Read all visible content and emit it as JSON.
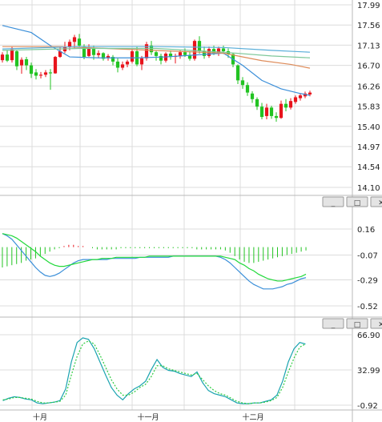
{
  "panels": [
    {
      "name": "price",
      "yticks": [
        "17.99",
        "17.56",
        "17.13",
        "16.70",
        "16.26",
        "15.83",
        "15.40",
        "14.97",
        "14.54",
        "14.10"
      ]
    },
    {
      "name": "macd",
      "yticks": [
        "0.16",
        "-0.07",
        "-0.29",
        "-0.52"
      ]
    },
    {
      "name": "kd",
      "yticks": [
        "66.90",
        "32.99",
        "-0.92"
      ]
    }
  ],
  "x_labels": [
    "十月",
    "十一月",
    "十二月"
  ],
  "colors": {
    "up": "#e8141c",
    "down": "#22c322",
    "ma5": "#3b8fd9",
    "ma10": "#de8c5a",
    "ma20": "#5aaed9",
    "ma30": "#7ec89a",
    "macd_dif": "#3b8fd9",
    "macd_dea": "#22d93b",
    "kd_k": "#1aa3b0",
    "kd_d": "#2ecc40",
    "grid": "#dcdcdc",
    "divider": "#b8b8b8"
  },
  "window_buttons": [
    "minimize",
    "maximize",
    "close"
  ],
  "chart_data": [
    {
      "type": "candlestick",
      "panel": "price",
      "ylim": [
        14.1,
        17.99
      ],
      "ohlc": [
        [
          16.81,
          16.98,
          16.76,
          16.93
        ],
        [
          16.93,
          17.02,
          16.77,
          16.8
        ],
        [
          16.81,
          17.1,
          16.76,
          17.04
        ],
        [
          17.0,
          17.02,
          16.6,
          16.68
        ],
        [
          16.7,
          16.87,
          16.52,
          16.82
        ],
        [
          16.83,
          16.88,
          16.6,
          16.7
        ],
        [
          16.7,
          16.76,
          16.43,
          16.52
        ],
        [
          16.55,
          16.62,
          16.4,
          16.48
        ],
        [
          16.48,
          16.56,
          16.42,
          16.5
        ],
        [
          16.5,
          16.6,
          16.45,
          16.55
        ],
        [
          16.55,
          16.62,
          16.18,
          16.53
        ],
        [
          16.53,
          16.9,
          16.52,
          16.88
        ],
        [
          16.88,
          17.1,
          16.86,
          17.0
        ],
        [
          17.0,
          17.2,
          16.96,
          17.1
        ],
        [
          17.1,
          17.25,
          17.02,
          17.2
        ],
        [
          17.2,
          17.35,
          17.05,
          17.3
        ],
        [
          17.27,
          17.37,
          17.08,
          17.12
        ],
        [
          17.1,
          17.15,
          16.83,
          16.88
        ],
        [
          16.9,
          17.15,
          16.88,
          17.08
        ],
        [
          17.05,
          17.12,
          16.82,
          16.92
        ],
        [
          16.92,
          17.02,
          16.86,
          16.96
        ],
        [
          16.96,
          16.98,
          16.8,
          16.84
        ],
        [
          16.86,
          16.94,
          16.8,
          16.9
        ],
        [
          16.88,
          16.92,
          16.7,
          16.78
        ],
        [
          16.78,
          16.85,
          16.55,
          16.65
        ],
        [
          16.65,
          16.78,
          16.6,
          16.72
        ],
        [
          16.72,
          16.82,
          16.66,
          16.78
        ],
        [
          16.78,
          17.05,
          16.74,
          17.0
        ],
        [
          17.0,
          17.1,
          16.68,
          16.72
        ],
        [
          16.72,
          16.9,
          16.6,
          16.85
        ],
        [
          16.85,
          17.2,
          16.8,
          17.15
        ],
        [
          17.12,
          17.22,
          16.92,
          16.98
        ],
        [
          16.98,
          17.02,
          16.8,
          16.9
        ],
        [
          16.9,
          16.95,
          16.72,
          16.8
        ],
        [
          16.8,
          16.98,
          16.76,
          16.95
        ],
        [
          16.95,
          17.02,
          16.82,
          16.88
        ],
        [
          16.88,
          16.95,
          16.74,
          16.9
        ],
        [
          16.9,
          17.02,
          16.84,
          16.98
        ],
        [
          16.98,
          17.06,
          16.88,
          16.92
        ],
        [
          16.92,
          17.0,
          16.8,
          16.84
        ],
        [
          16.84,
          17.25,
          16.8,
          17.22
        ],
        [
          17.22,
          17.32,
          16.95,
          17.0
        ],
        [
          17.0,
          17.1,
          16.84,
          16.9
        ],
        [
          16.9,
          17.1,
          16.86,
          17.05
        ],
        [
          17.05,
          17.12,
          16.92,
          16.96
        ],
        [
          16.96,
          17.1,
          16.9,
          17.06
        ],
        [
          17.06,
          17.12,
          16.94,
          17.0
        ],
        [
          17.0,
          17.06,
          16.86,
          16.94
        ],
        [
          16.94,
          16.96,
          16.66,
          16.72
        ],
        [
          16.7,
          16.72,
          16.3,
          16.38
        ],
        [
          16.38,
          16.45,
          16.2,
          16.28
        ],
        [
          16.28,
          16.34,
          16.05,
          16.12
        ],
        [
          16.1,
          16.15,
          15.9,
          15.98
        ],
        [
          15.98,
          16.02,
          15.75,
          15.82
        ],
        [
          15.82,
          15.9,
          15.55,
          15.6
        ],
        [
          15.62,
          15.88,
          15.55,
          15.8
        ],
        [
          15.8,
          15.84,
          15.56,
          15.62
        ],
        [
          15.62,
          15.7,
          15.5,
          15.58
        ],
        [
          15.58,
          15.95,
          15.56,
          15.88
        ],
        [
          15.88,
          15.98,
          15.72,
          15.8
        ],
        [
          15.8,
          16.0,
          15.76,
          15.94
        ],
        [
          15.92,
          16.06,
          15.88,
          16.02
        ],
        [
          16.0,
          16.1,
          15.95,
          16.06
        ],
        [
          16.04,
          16.14,
          16.0,
          16.1
        ],
        [
          16.08,
          16.16,
          16.04,
          16.12
        ]
      ],
      "ma_series": [
        {
          "name": "MA5",
          "points": [
            [
              0,
              17.55
            ],
            [
              6,
              17.4
            ],
            [
              10,
              17.12
            ],
            [
              14,
              16.88
            ],
            [
              20,
              16.86
            ],
            [
              28,
              16.86
            ],
            [
              34,
              16.88
            ],
            [
              40,
              16.92
            ],
            [
              46,
              16.96
            ],
            [
              50,
              16.7
            ],
            [
              54,
              16.38
            ],
            [
              58,
              16.2
            ],
            [
              62,
              16.1
            ],
            [
              64,
              16.06
            ]
          ]
        },
        {
          "name": "MA10",
          "points": [
            [
              0,
              17.1
            ],
            [
              12,
              17.1
            ],
            [
              24,
              17.05
            ],
            [
              36,
              17.0
            ],
            [
              46,
              16.96
            ],
            [
              54,
              16.8
            ],
            [
              60,
              16.72
            ],
            [
              64,
              16.64
            ]
          ]
        },
        {
          "name": "MA20",
          "points": [
            [
              0,
              17.05
            ],
            [
              16,
              17.1
            ],
            [
              32,
              17.1
            ],
            [
              46,
              17.08
            ],
            [
              56,
              17.02
            ],
            [
              64,
              16.98
            ]
          ]
        },
        {
          "name": "MA30",
          "points": [
            [
              0,
              17.02
            ],
            [
              16,
              17.06
            ],
            [
              32,
              17.06
            ],
            [
              46,
              16.98
            ],
            [
              56,
              16.9
            ],
            [
              64,
              16.86
            ]
          ]
        }
      ]
    },
    {
      "type": "macd",
      "panel": "macd",
      "ylim": [
        -0.52,
        0.16
      ],
      "histogram": [
        -0.18,
        -0.17,
        -0.16,
        -0.15,
        -0.14,
        -0.12,
        -0.11,
        -0.1,
        -0.08,
        -0.06,
        -0.04,
        -0.02,
        -0.01,
        0.01,
        0.02,
        0.02,
        0.01,
        0.01,
        0.0,
        -0.01,
        -0.02,
        -0.02,
        -0.02,
        -0.02,
        -0.02,
        -0.01,
        -0.01,
        -0.01,
        -0.01,
        -0.01,
        -0.01,
        -0.01,
        -0.01,
        -0.01,
        -0.01,
        -0.01,
        -0.01,
        -0.01,
        -0.01,
        -0.01,
        -0.01,
        -0.02,
        -0.02,
        -0.02,
        -0.02,
        -0.02,
        -0.02,
        -0.03,
        -0.05,
        -0.08,
        -0.11,
        -0.13,
        -0.14,
        -0.14,
        -0.13,
        -0.12,
        -0.11,
        -0.1,
        -0.09,
        -0.08,
        -0.07,
        -0.06,
        -0.05,
        -0.04,
        -0.03
      ],
      "dif": [
        0.12,
        0.1,
        0.07,
        0.02,
        -0.03,
        -0.08,
        -0.13,
        -0.18,
        -0.22,
        -0.25,
        -0.26,
        -0.25,
        -0.23,
        -0.2,
        -0.17,
        -0.14,
        -0.12,
        -0.11,
        -0.11,
        -0.11,
        -0.11,
        -0.11,
        -0.11,
        -0.1,
        -0.1,
        -0.1,
        -0.1,
        -0.1,
        -0.1,
        -0.09,
        -0.09,
        -0.09,
        -0.09,
        -0.09,
        -0.09,
        -0.09,
        -0.08,
        -0.08,
        -0.08,
        -0.08,
        -0.08,
        -0.08,
        -0.08,
        -0.08,
        -0.08,
        -0.08,
        -0.09,
        -0.11,
        -0.14,
        -0.18,
        -0.22,
        -0.26,
        -0.3,
        -0.33,
        -0.35,
        -0.37,
        -0.37,
        -0.37,
        -0.36,
        -0.35,
        -0.33,
        -0.32,
        -0.3,
        -0.28,
        -0.27
      ],
      "dea": [
        0.12,
        0.11,
        0.1,
        0.08,
        0.05,
        0.02,
        -0.01,
        -0.04,
        -0.08,
        -0.11,
        -0.14,
        -0.16,
        -0.17,
        -0.17,
        -0.16,
        -0.15,
        -0.14,
        -0.13,
        -0.12,
        -0.11,
        -0.11,
        -0.1,
        -0.1,
        -0.1,
        -0.09,
        -0.09,
        -0.09,
        -0.09,
        -0.09,
        -0.09,
        -0.09,
        -0.08,
        -0.08,
        -0.08,
        -0.08,
        -0.08,
        -0.08,
        -0.08,
        -0.08,
        -0.08,
        -0.08,
        -0.08,
        -0.08,
        -0.08,
        -0.08,
        -0.08,
        -0.08,
        -0.09,
        -0.1,
        -0.11,
        -0.14,
        -0.16,
        -0.19,
        -0.21,
        -0.24,
        -0.26,
        -0.28,
        -0.29,
        -0.3,
        -0.3,
        -0.29,
        -0.28,
        -0.27,
        -0.26,
        -0.24
      ]
    },
    {
      "type": "line",
      "panel": "kd",
      "ylim": [
        -0.92,
        90
      ],
      "series": [
        {
          "name": "K",
          "values": [
            5,
            8,
            10,
            9,
            7,
            6,
            2,
            1,
            2,
            3,
            5,
            20,
            55,
            80,
            86,
            84,
            72,
            55,
            38,
            22,
            12,
            6,
            14,
            20,
            24,
            30,
            45,
            58,
            48,
            44,
            43,
            40,
            38,
            36,
            42,
            28,
            18,
            14,
            12,
            10,
            6,
            2,
            1,
            1,
            2,
            2,
            4,
            6,
            12,
            30,
            55,
            72,
            80,
            78
          ]
        },
        {
          "name": "D",
          "values": [
            6,
            7,
            9,
            9,
            8,
            7,
            4,
            2,
            2,
            3,
            4,
            12,
            38,
            62,
            78,
            82,
            78,
            64,
            48,
            32,
            20,
            12,
            12,
            16,
            22,
            26,
            36,
            50,
            50,
            46,
            44,
            42,
            40,
            38,
            40,
            32,
            24,
            18,
            14,
            12,
            8,
            4,
            2,
            1,
            2,
            2,
            3,
            5,
            9,
            22,
            42,
            60,
            74,
            78
          ]
        }
      ]
    }
  ]
}
